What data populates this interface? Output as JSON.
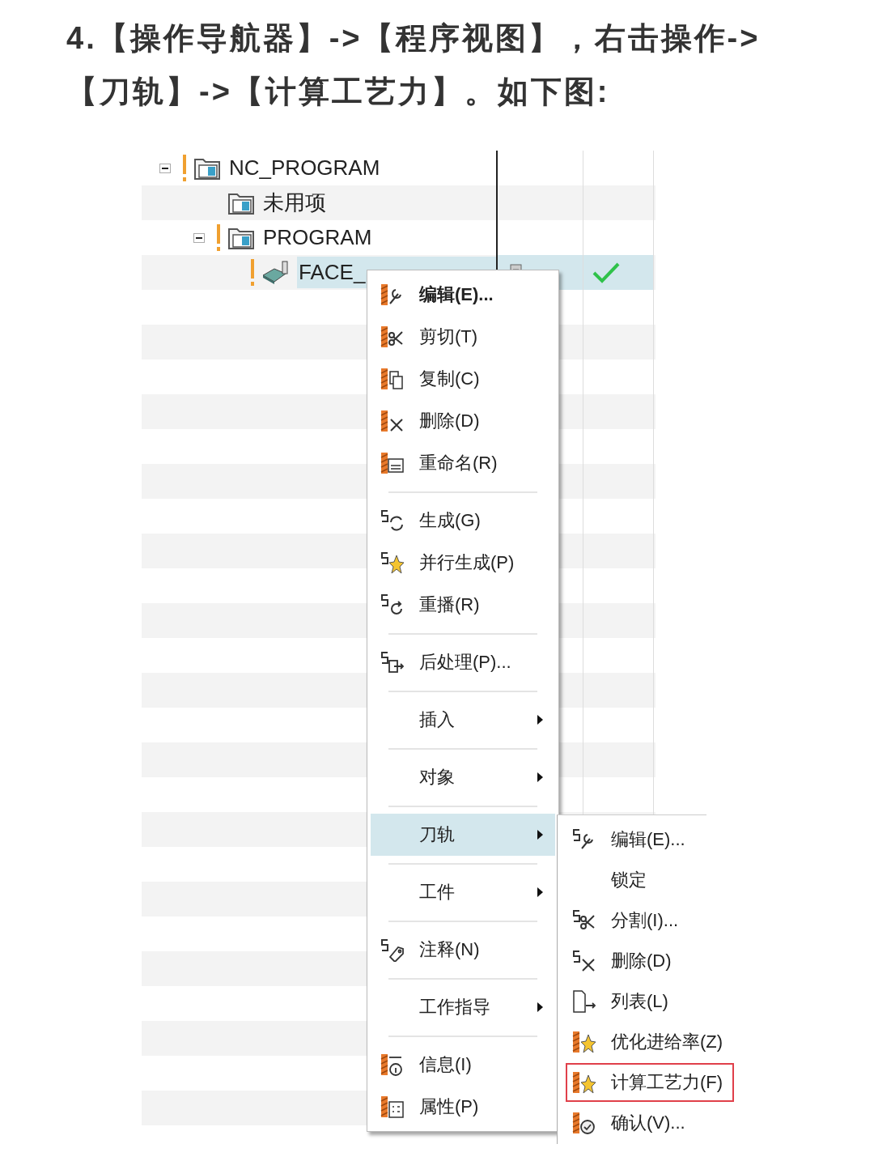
{
  "heading": "4.【操作导航器】->【程序视图】，右击操作->【刀轨】->【计算工艺力】。如下图:",
  "tree": [
    {
      "label": "NC_PROGRAM",
      "kind": "folder",
      "expanded": true,
      "flag": true,
      "selected": false,
      "children": [
        {
          "label": "未用项",
          "kind": "folder",
          "flag": false,
          "selected": false
        },
        {
          "label": "PROGRAM",
          "kind": "folder",
          "expanded": true,
          "flag": true,
          "selected": false,
          "children": [
            {
              "label": "FACE_",
              "kind": "operation",
              "flag": true,
              "selected": true,
              "verified": true
            }
          ]
        }
      ]
    }
  ],
  "context_menu": [
    {
      "kind": "item",
      "label": "编辑(E)...",
      "bold": true,
      "has_submenu": false,
      "selected": false
    },
    {
      "kind": "item",
      "label": "剪切(T)",
      "has_submenu": false,
      "selected": false
    },
    {
      "kind": "item",
      "label": "复制(C)",
      "has_submenu": false,
      "selected": false
    },
    {
      "kind": "item",
      "label": "删除(D)",
      "has_submenu": false,
      "selected": false
    },
    {
      "kind": "item",
      "label": "重命名(R)",
      "has_submenu": false,
      "selected": false
    },
    {
      "kind": "separator"
    },
    {
      "kind": "item",
      "label": "生成(G)",
      "has_submenu": false,
      "selected": false
    },
    {
      "kind": "item",
      "label": "并行生成(P)",
      "has_submenu": false,
      "selected": false
    },
    {
      "kind": "item",
      "label": "重播(R)",
      "has_submenu": false,
      "selected": false
    },
    {
      "kind": "separator"
    },
    {
      "kind": "item",
      "label": "后处理(P)...",
      "has_submenu": false,
      "selected": false
    },
    {
      "kind": "separator"
    },
    {
      "kind": "item",
      "label": "插入",
      "has_submenu": true,
      "selected": false
    },
    {
      "kind": "separator"
    },
    {
      "kind": "item",
      "label": "对象",
      "has_submenu": true,
      "selected": false
    },
    {
      "kind": "separator"
    },
    {
      "kind": "item",
      "label": "刀轨",
      "has_submenu": true,
      "selected": true
    },
    {
      "kind": "separator"
    },
    {
      "kind": "item",
      "label": "工件",
      "has_submenu": true,
      "selected": false
    },
    {
      "kind": "separator"
    },
    {
      "kind": "item",
      "label": "注释(N)",
      "has_submenu": false,
      "selected": false
    },
    {
      "kind": "separator"
    },
    {
      "kind": "item",
      "label": "工作指导",
      "has_submenu": true,
      "selected": false
    },
    {
      "kind": "separator"
    },
    {
      "kind": "item",
      "label": "信息(I)",
      "has_submenu": false,
      "selected": false
    },
    {
      "kind": "item",
      "label": "属性(P)",
      "has_submenu": false,
      "selected": false
    }
  ],
  "submenu": [
    {
      "label": "编辑(E)...",
      "outlined": false
    },
    {
      "label": "锁定",
      "outlined": false
    },
    {
      "label": "分割(I)...",
      "outlined": false
    },
    {
      "label": "删除(D)",
      "outlined": false
    },
    {
      "label": "列表(L)",
      "outlined": false
    },
    {
      "label": "优化进给率(Z)",
      "outlined": false
    },
    {
      "label": "计算工艺力(F)",
      "outlined": true
    },
    {
      "label": "确认(V)...",
      "outlined": false
    }
  ]
}
